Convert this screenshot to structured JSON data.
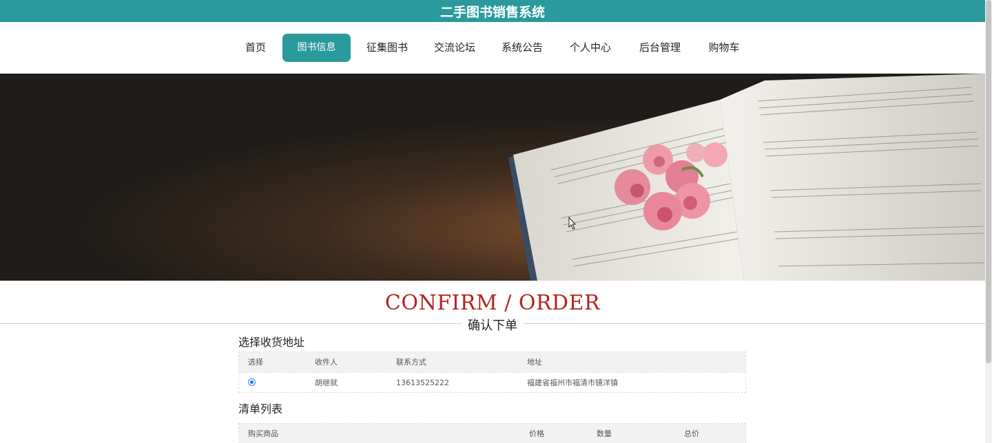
{
  "header": {
    "title": "二手图书销售系统",
    "bg_color": "#2a9a9c"
  },
  "nav": {
    "items": [
      {
        "label": "首页"
      },
      {
        "label": "图书信息"
      },
      {
        "label": "征集图书"
      },
      {
        "label": "交流论坛"
      },
      {
        "label": "系统公告"
      },
      {
        "label": "个人中心"
      },
      {
        "label": "后台管理"
      },
      {
        "label": "购物车"
      }
    ],
    "active_index": 1
  },
  "banner": {
    "description_icon": "sheet-music-book-with-flowers"
  },
  "section": {
    "title_en": "CONFIRM / ORDER",
    "title_cn": "确认下单",
    "title_en_color": "#b3241f"
  },
  "address": {
    "heading": "选择收货地址",
    "columns": [
      "选择",
      "收件人",
      "联系方式",
      "地址"
    ],
    "rows": [
      {
        "selected": true,
        "name": "胡继就",
        "phone": "13613525222",
        "address": "福建省福州市福清市镜洋镇"
      }
    ]
  },
  "order_list": {
    "heading": "清单列表",
    "columns": [
      "购买商品",
      "价格",
      "数量",
      "总价"
    ]
  }
}
